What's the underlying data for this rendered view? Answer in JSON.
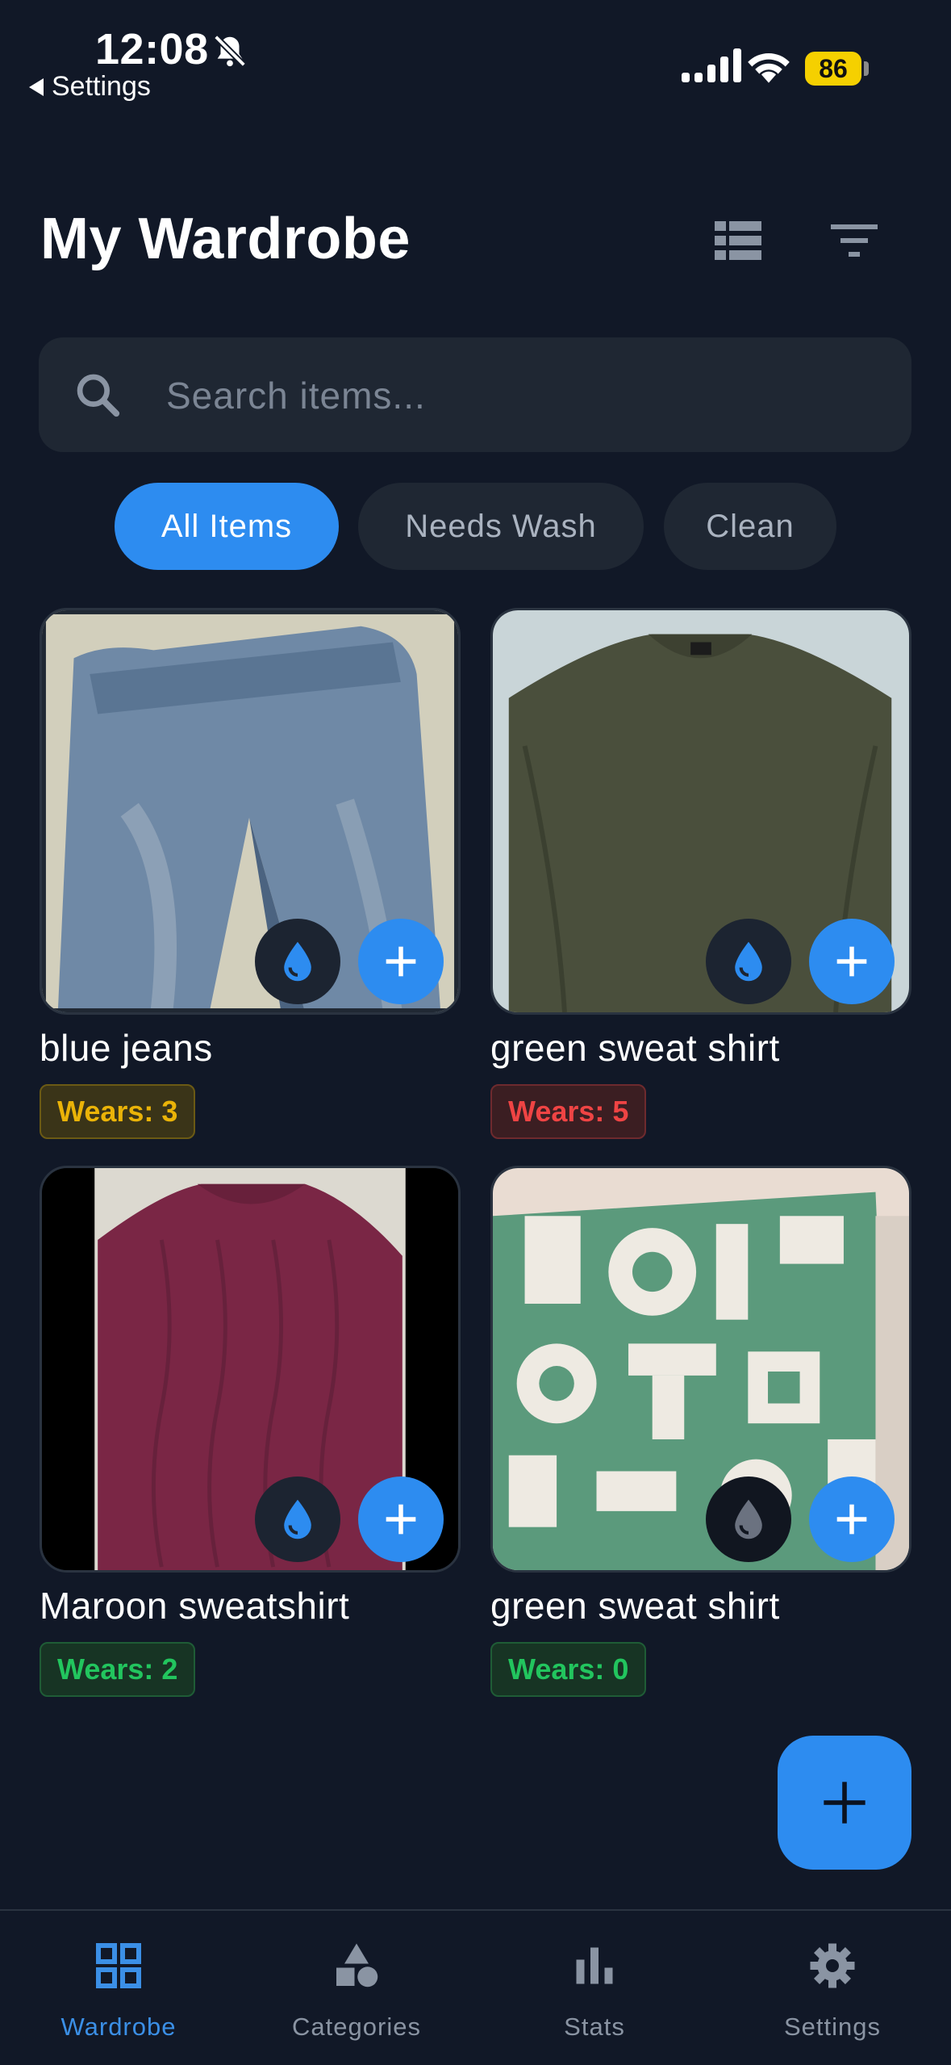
{
  "status_bar": {
    "time": "12:08",
    "back_label": "Settings",
    "battery": "86",
    "icons": [
      "bell-slash-icon",
      "cellular-signal-icon",
      "wifi-icon",
      "battery-icon"
    ]
  },
  "header": {
    "title": "My Wardrobe",
    "icons": [
      "list-view-icon",
      "filter-icon"
    ]
  },
  "search": {
    "placeholder": "Search items...",
    "value": "",
    "icon": "search-icon"
  },
  "filters": [
    {
      "label": "All Items",
      "active": true
    },
    {
      "label": "Needs Wash",
      "active": false
    },
    {
      "label": "Clean",
      "active": false
    }
  ],
  "items": [
    {
      "name": "blue jeans",
      "wears": "Wears: 3",
      "wear_color": "#eab308",
      "photo": "blue denim jeans"
    },
    {
      "name": "green sweat shirt",
      "wears": "Wears: 5",
      "wear_color": "#ef4444",
      "photo": "olive green sweater"
    },
    {
      "name": "Maroon sweatshirt",
      "wears": "Wears: 2",
      "wear_color": "#22c55e",
      "photo": "maroon cable-knit sweater"
    },
    {
      "name": "green sweat shirt",
      "wears": "Wears: 0",
      "wear_color": "#22c55e",
      "photo": "green and white letter-pattern sweater"
    }
  ],
  "item_actions": {
    "wash_icon": "water-drop-icon",
    "add_icon": "plus-icon"
  },
  "fab": {
    "icon": "plus-icon"
  },
  "bottom_nav": [
    {
      "label": "Wardrobe",
      "icon": "grid-icon",
      "active": true
    },
    {
      "label": "Categories",
      "icon": "shapes-icon",
      "active": false
    },
    {
      "label": "Stats",
      "icon": "bar-chart-icon",
      "active": false
    },
    {
      "label": "Settings",
      "icon": "gear-icon",
      "active": false
    }
  ],
  "colors": {
    "background": "#111827",
    "surface": "#1f2733",
    "accent": "#2d8cf0",
    "nav_active": "#3b8fe6",
    "nav_inactive": "#8a94a3"
  }
}
